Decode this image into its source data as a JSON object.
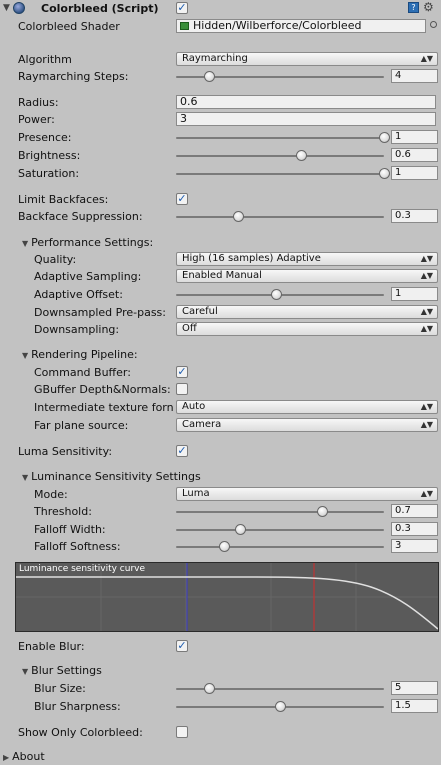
{
  "header": {
    "title": "Colorbleed (Script)",
    "help_label": "?"
  },
  "shader": {
    "label": "Colorbleed Shader",
    "value": "Hidden/Wilberforce/Colorbleed"
  },
  "algorithm": {
    "label": "Algorithm",
    "value": "Raymarching"
  },
  "raymarching_steps": {
    "label": "Raymarching Steps:",
    "value": "4",
    "fraction": 0.16
  },
  "radius": {
    "label": "Radius:",
    "value": "0.6"
  },
  "power": {
    "label": "Power:",
    "value": "3"
  },
  "presence": {
    "label": "Presence:",
    "value": "1",
    "fraction": 1.0
  },
  "brightness": {
    "label": "Brightness:",
    "value": "0.6",
    "fraction": 0.6
  },
  "saturation": {
    "label": "Saturation:",
    "value": "1",
    "fraction": 1.0
  },
  "limit_backfaces": {
    "label": "Limit Backfaces:",
    "checked": true
  },
  "backface_suppression": {
    "label": "Backface Suppression:",
    "value": "0.3",
    "fraction": 0.3
  },
  "performance": {
    "title": "Performance Settings:",
    "quality": {
      "label": "Quality:",
      "value": "High (16 samples) Adaptive"
    },
    "adaptive_sampling": {
      "label": "Adaptive Sampling:",
      "value": "Enabled Manual"
    },
    "adaptive_offset": {
      "label": "Adaptive Offset:",
      "value": "1",
      "fraction": 0.48
    },
    "downsampled_prepass": {
      "label": "Downsampled Pre-pass:",
      "value": "Careful"
    },
    "downsampling": {
      "label": "Downsampling:",
      "value": "Off"
    }
  },
  "rendering": {
    "title": "Rendering Pipeline:",
    "command_buffer": {
      "label": "Command Buffer:",
      "checked": true
    },
    "gbuffer": {
      "label": "GBuffer Depth&Normals:",
      "checked": false
    },
    "intermediate": {
      "label": "Intermediate texture forn",
      "value": "Auto"
    },
    "far_plane": {
      "label": "Far plane source:",
      "value": "Camera"
    }
  },
  "luma_sensitivity": {
    "label": "Luma Sensitivity:",
    "checked": true
  },
  "luminance": {
    "title": "Luminance Sensitivity Settings",
    "mode": {
      "label": "Mode:",
      "value": "Luma"
    },
    "threshold": {
      "label": "Threshold:",
      "value": "0.7",
      "fraction": 0.7
    },
    "falloff_width": {
      "label": "Falloff Width:",
      "value": "0.3",
      "fraction": 0.31
    },
    "falloff_softness": {
      "label": "Falloff Softness:",
      "value": "3",
      "fraction": 0.23
    }
  },
  "curve": {
    "title": "Luminance sensitivity curve"
  },
  "enable_blur": {
    "label": "Enable Blur:",
    "checked": true
  },
  "blur": {
    "title": "Blur Settings",
    "size": {
      "label": "Blur Size:",
      "value": "5",
      "fraction": 0.16
    },
    "sharpness": {
      "label": "Blur Sharpness:",
      "value": "1.5",
      "fraction": 0.5
    }
  },
  "show_only": {
    "label": "Show Only Colorbleed:",
    "checked": false
  },
  "about": {
    "title": "About"
  },
  "icons": {
    "fold_open": "▼",
    "fold_closed": "▶",
    "check": "✓",
    "dropdown": "▲▼",
    "gear": "⚙"
  }
}
